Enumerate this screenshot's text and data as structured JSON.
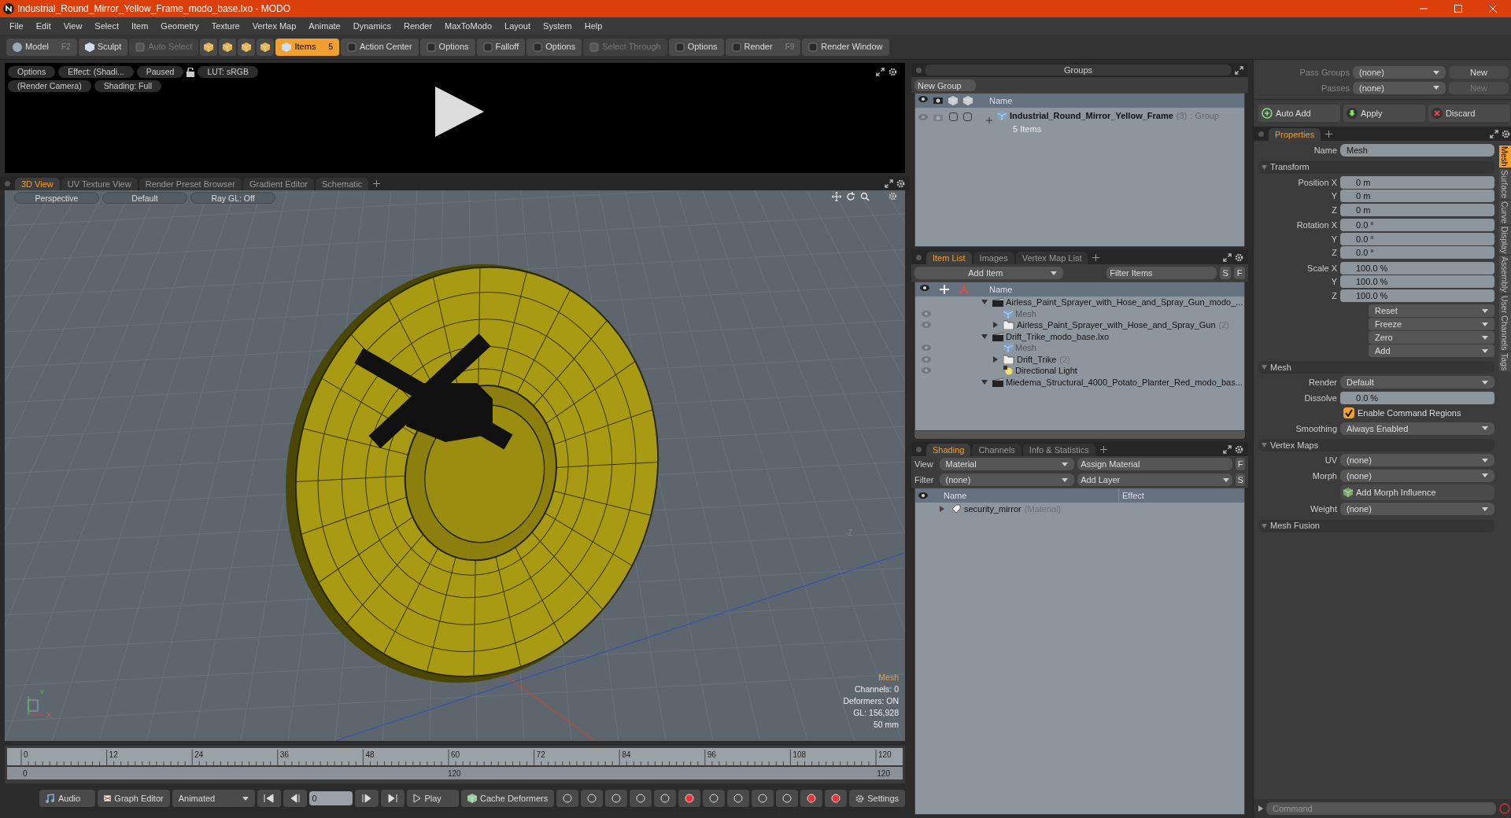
{
  "window": {
    "title": "Industrial_Round_Mirror_Yellow_Frame_modo_base.lxo - MODO"
  },
  "menu": [
    "File",
    "Edit",
    "View",
    "Select",
    "Item",
    "Geometry",
    "Texture",
    "Vertex Map",
    "Animate",
    "Dynamics",
    "Render",
    "MaxToModo",
    "Layout",
    "System",
    "Help"
  ],
  "toolbar": [
    {
      "kind": "mode",
      "label": "Model",
      "shortcut": "F2",
      "selected": false
    },
    {
      "kind": "mode",
      "label": "Sculpt",
      "selected": false
    },
    {
      "kind": "tool",
      "label": "Auto Select",
      "disabled": true
    },
    {
      "kind": "icons"
    },
    {
      "kind": "mode",
      "label": "Items",
      "shortcut": "5",
      "selected": true
    },
    {
      "kind": "tool",
      "label": "Action Center",
      "disabled": false
    },
    {
      "kind": "tool",
      "label": "Options",
      "disabled": false
    },
    {
      "kind": "tool",
      "label": "Falloff",
      "disabled": false
    },
    {
      "kind": "tool",
      "label": "Options",
      "disabled": false
    },
    {
      "kind": "tool",
      "label": "Select Through",
      "disabled": true
    },
    {
      "kind": "tool",
      "label": "Options",
      "disabled": false
    },
    {
      "kind": "tool",
      "label": "Render",
      "shortcut": "F9",
      "disabled": false
    },
    {
      "kind": "tool",
      "label": "Render Window",
      "disabled": false
    }
  ],
  "preview": {
    "row_1": [
      "Options",
      "Effect: (Shadi...",
      "Paused",
      "LUT: sRGB"
    ],
    "row_2": [
      "(Render Camera)",
      "Shading: Full"
    ]
  },
  "viewport_tabs": [
    {
      "label": "3D View",
      "selected": true
    },
    {
      "label": "UV Texture View",
      "selected": false
    },
    {
      "label": "Render Preset Browser",
      "selected": false
    },
    {
      "label": "Gradient Editor",
      "selected": false
    },
    {
      "label": "Schematic",
      "selected": false
    }
  ],
  "viewport": {
    "buttons": [
      "Perspective",
      "Default",
      "Ray GL: Off"
    ],
    "axis_label": "-Z",
    "gizmo_labels": [
      "Y",
      "X"
    ],
    "info_title": "Mesh",
    "info": [
      "Channels: 0",
      "Deformers: ON",
      "GL: 156,928",
      "50 mm"
    ]
  },
  "timeline": {
    "ticks": [
      "0",
      "12",
      "24",
      "36",
      "48",
      "60",
      "72",
      "84",
      "96",
      "108",
      "120"
    ],
    "range_start": "0",
    "range_middle": "120",
    "range_end": "120"
  },
  "transport": {
    "audio": "Audio",
    "graph_editor": "Graph Editor",
    "mode": "Animated",
    "frame": "0",
    "play": "Play",
    "cache": "Cache Deformers",
    "settings": "Settings"
  },
  "groups": {
    "title": "Groups",
    "new_group": "New Group",
    "column": "Name",
    "rows": [
      {
        "name": "Industrial_Round_Mirror_Yellow_Frame",
        "count": "(3)",
        "type": ": Group",
        "detail": "5 Items"
      }
    ]
  },
  "item_list": {
    "tabs": [
      {
        "label": "Item List",
        "selected": true
      },
      {
        "label": "Images",
        "selected": false
      },
      {
        "label": "Vertex Map List",
        "selected": false
      }
    ],
    "add_item": "Add Item",
    "filter": {
      "placeholder": "Filter Items"
    },
    "s": "S",
    "f": "F",
    "column": "Name",
    "items": [
      {
        "kind": "scene",
        "name": "Airless_Paint_Sprayer_with_Hose_and_Spray_Gun_modo_...",
        "expanded": true,
        "children": [
          {
            "kind": "mesh",
            "name": "Mesh",
            "visible": true
          },
          {
            "kind": "folder",
            "name": "Airless_Paint_Sprayer_with_Hose_and_Spray_Gun",
            "count": "(2)",
            "expanded": false,
            "visible": true
          }
        ]
      },
      {
        "kind": "scene",
        "name": "Drift_Trike_modo_base.lxo",
        "expanded": true,
        "children": [
          {
            "kind": "mesh",
            "name": "Mesh",
            "visible": true
          },
          {
            "kind": "folder",
            "name": "Drift_Trike",
            "count": "(2)",
            "expanded": false,
            "visible": true
          },
          {
            "kind": "light",
            "name": "Directional Light",
            "visible": true
          }
        ]
      },
      {
        "kind": "scene",
        "name": "Miedema_Structural_4000_Potato_Planter_Red_modo_bas...",
        "expanded": true
      }
    ]
  },
  "shading": {
    "tabs": [
      {
        "label": "Shading",
        "selected": true
      },
      {
        "label": "Channels",
        "selected": false
      },
      {
        "label": "Info & Statistics",
        "selected": false
      }
    ],
    "view_label": "View",
    "view": "Material",
    "assign": "Assign Material",
    "f": "F",
    "filter_label": "Filter",
    "filter": "(none)",
    "add_layer": "Add Layer",
    "s": "S",
    "columns": [
      "Name",
      "Effect"
    ],
    "rows": [
      {
        "name": "security_mirror",
        "type": "(Material)"
      }
    ]
  },
  "passes": {
    "pass_groups_label": "Pass Groups",
    "pass_groups": "(none)",
    "pass_groups_new": "New",
    "passes_label": "Passes",
    "passes": "(none)",
    "passes_new": "New"
  },
  "actions": [
    "Auto Add",
    "Apply",
    "Discard"
  ],
  "properties": {
    "tabs": [
      {
        "label": "Properties",
        "selected": true
      }
    ],
    "side_tabs": [
      {
        "label": "Mesh",
        "selected": true
      },
      {
        "label": "Surface",
        "selected": false
      },
      {
        "label": "Curve",
        "selected": false
      },
      {
        "label": "Display",
        "selected": false
      },
      {
        "label": "Assembly",
        "selected": false
      },
      {
        "label": "User Channels",
        "selected": false
      },
      {
        "label": "Tags",
        "selected": false
      }
    ],
    "rows": [
      {
        "kind": "name",
        "label": "Name",
        "value": "Mesh"
      },
      {
        "kind": "section",
        "label": "Transform"
      },
      {
        "kind": "vector",
        "labels": [
          "Position X",
          "Y",
          "Z"
        ],
        "values": [
          "0 m",
          "0 m",
          "0 m"
        ]
      },
      {
        "kind": "vector",
        "labels": [
          "Rotation X",
          "Y",
          "Z"
        ],
        "values": [
          "0.0 °",
          "0.0 °",
          "0.0 °"
        ]
      },
      {
        "kind": "vector",
        "labels": [
          "Scale X",
          "Y",
          "Z"
        ],
        "values": [
          "100.0 %",
          "100.0 %",
          "100.0 %"
        ]
      },
      {
        "kind": "menus",
        "values": [
          "Reset",
          "Freeze",
          "Zero",
          "Add"
        ]
      },
      {
        "kind": "section",
        "label": "Mesh"
      },
      {
        "kind": "dropdown",
        "label": "Render",
        "value": "Default"
      },
      {
        "kind": "number",
        "label": "Dissolve",
        "value": "0.0 %"
      },
      {
        "kind": "checkbox",
        "label": "Enable Command Regions",
        "checked": true
      },
      {
        "kind": "dropdown",
        "label": "Smoothing",
        "value": "Always Enabled"
      },
      {
        "kind": "section",
        "label": "Vertex Maps"
      },
      {
        "kind": "dropdown",
        "label": "UV",
        "value": "(none)"
      },
      {
        "kind": "dropdown",
        "label": "Morph",
        "value": "(none)"
      },
      {
        "kind": "button",
        "label": "Add Morph Influence"
      },
      {
        "kind": "dropdown",
        "label": "Weight",
        "value": "(none)"
      },
      {
        "kind": "section",
        "label": "Mesh Fusion"
      }
    ]
  },
  "command": {
    "placeholder": "Command"
  }
}
